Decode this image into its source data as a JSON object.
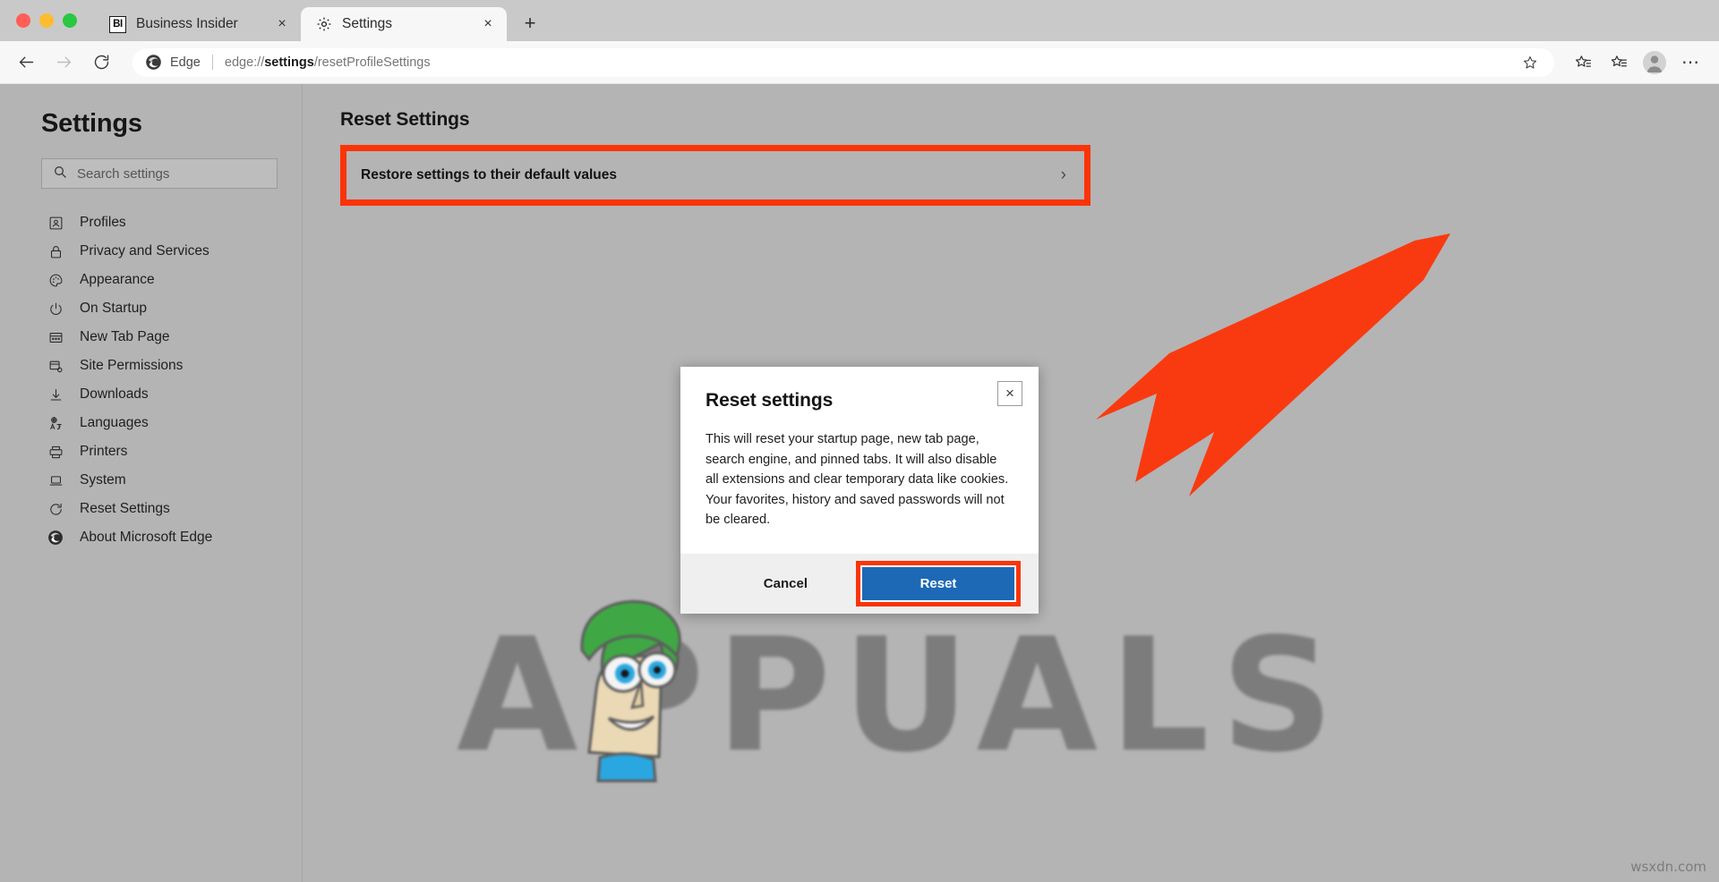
{
  "browser": {
    "tabs": [
      {
        "title": "Business Insider",
        "favicon": "BI",
        "active": false,
        "close_label": "×"
      },
      {
        "title": "Settings",
        "favicon": "gear-icon",
        "active": true,
        "close_label": "×"
      }
    ],
    "new_tab_label": "+",
    "toolbar": {
      "back_label": "←",
      "forward_label": "→",
      "reload_label": "↻",
      "brand": "Edge",
      "url_prefix": "edge://",
      "url_bold": "settings",
      "url_suffix": "/resetProfileSettings",
      "url_full": "edge://settings/resetProfileSettings",
      "star_label": "☆",
      "collections_label": "collections-icon",
      "profile_label": "profile-avatar",
      "more_label": "⋯"
    }
  },
  "sidebar": {
    "title": "Settings",
    "search": {
      "placeholder": "Search settings",
      "value": ""
    },
    "items": [
      {
        "label": "Profiles",
        "icon": "profile-card-icon"
      },
      {
        "label": "Privacy and Services",
        "icon": "lock-icon"
      },
      {
        "label": "Appearance",
        "icon": "palette-icon"
      },
      {
        "label": "On Startup",
        "icon": "power-icon"
      },
      {
        "label": "New Tab Page",
        "icon": "newtab-icon"
      },
      {
        "label": "Site Permissions",
        "icon": "permissions-icon"
      },
      {
        "label": "Downloads",
        "icon": "download-icon"
      },
      {
        "label": "Languages",
        "icon": "languages-icon"
      },
      {
        "label": "Printers",
        "icon": "printer-icon"
      },
      {
        "label": "System",
        "icon": "laptop-icon"
      },
      {
        "label": "Reset Settings",
        "icon": "reset-circular-icon"
      },
      {
        "label": "About Microsoft Edge",
        "icon": "edge-logo-icon"
      }
    ]
  },
  "main": {
    "page_title": "Reset Settings",
    "restore_row": {
      "label": "Restore settings to their default values",
      "chevron": "›"
    }
  },
  "dialog": {
    "title": "Reset settings",
    "body": "This will reset your startup page, new tab page, search engine, and pinned tabs. It will also disable all extensions and clear temporary data like cookies. Your favorites, history and saved passwords will not be cleared.",
    "cancel_label": "Cancel",
    "reset_label": "Reset",
    "close_label": "×"
  },
  "watermark": {
    "text": "APPUALS",
    "site_credit": "wsxdn.com"
  },
  "annotation": {
    "highlight_color": "#fa3409",
    "arrow_color": "#f93a10",
    "accent_blue": "#1d69b5"
  }
}
